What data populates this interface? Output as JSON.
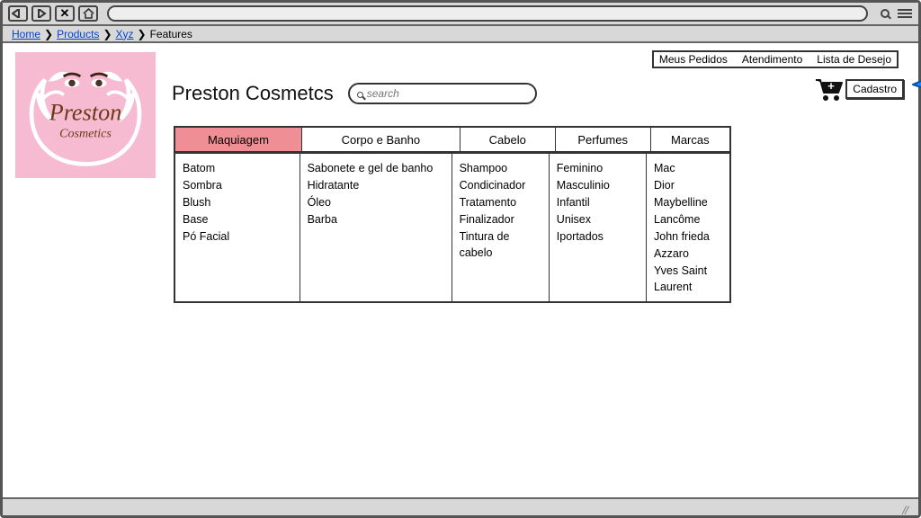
{
  "breadcrumb": {
    "home": "Home",
    "products": "Products",
    "xyz": "Xyz",
    "features": "Features"
  },
  "topLinks": {
    "orders": "Meus Pedidos",
    "support": "Atendimento",
    "wishlist": "Lista de Desejo"
  },
  "brand": {
    "title": "Preston Cosmetcs",
    "logoLine1": "Preston",
    "logoLine2": "Cosmetics"
  },
  "search": {
    "placeholder": "search"
  },
  "cadastro": "Cadastro",
  "tabs": {
    "t0": "Maquiagem",
    "t1": "Corpo e Banho",
    "t2": "Cabelo",
    "t3": "Perfumes",
    "t4": "Marcas"
  },
  "columns": {
    "maquiagem": [
      "Batom",
      "Sombra",
      "Blush",
      "Base",
      "Pó Facial"
    ],
    "corpo": [
      "Sabonete e gel de banho",
      "Hidratante",
      "Óleo",
      "Barba"
    ],
    "cabelo": [
      "Shampoo",
      "Condicinador",
      "Tratamento",
      "Finalizador",
      "Tintura de cabelo"
    ],
    "perfumes": [
      "Feminino",
      "Masculinio",
      "Infantil",
      "Unisex",
      "Iportados"
    ],
    "marcas": [
      "Mac",
      "Dior",
      "Maybelline",
      "Lancôme",
      "John frieda",
      "Azzaro",
      "Yves Saint Laurent"
    ]
  }
}
